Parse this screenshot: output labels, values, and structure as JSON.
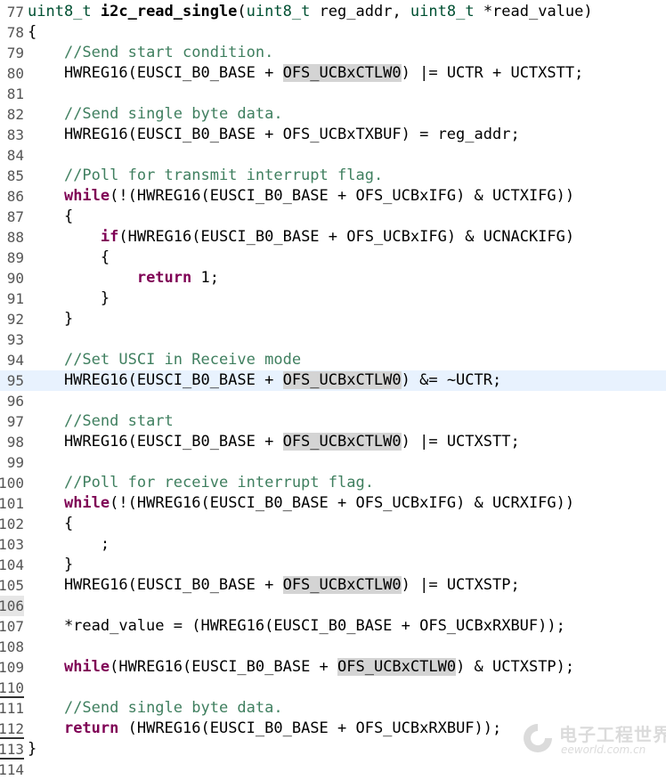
{
  "editor": {
    "language": "c",
    "current_line": "95",
    "lines": [
      {
        "num": "77",
        "tokens": [
          [
            "ty",
            "uint8_t "
          ],
          [
            "fn",
            "i2c_read_single"
          ],
          [
            "",
            "("
          ],
          [
            "ty",
            "uint8_t"
          ],
          [
            "",
            " reg_addr, "
          ],
          [
            "ty",
            "uint8_t"
          ],
          [
            "",
            " *read_value)"
          ]
        ]
      },
      {
        "num": "78",
        "tokens": [
          [
            "",
            "{"
          ]
        ]
      },
      {
        "num": "79",
        "tokens": [
          [
            "",
            "    "
          ],
          [
            "cm",
            "//Send start condition."
          ]
        ]
      },
      {
        "num": "80",
        "tokens": [
          [
            "",
            "    HWREG16(EUSCI_B0_BASE + "
          ],
          [
            "hl",
            "OFS_UCBxCTLW0"
          ],
          [
            "",
            ") |= UCTR + UCTXSTT;"
          ]
        ]
      },
      {
        "num": "81",
        "tokens": []
      },
      {
        "num": "82",
        "tokens": [
          [
            "",
            "    "
          ],
          [
            "cm",
            "//Send single byte data."
          ]
        ]
      },
      {
        "num": "83",
        "tokens": [
          [
            "",
            "    HWREG16(EUSCI_B0_BASE + OFS_UCBxTXBUF) = reg_addr;"
          ]
        ]
      },
      {
        "num": "84",
        "tokens": []
      },
      {
        "num": "85",
        "tokens": [
          [
            "",
            "    "
          ],
          [
            "cm",
            "//Poll for transmit interrupt flag."
          ]
        ]
      },
      {
        "num": "86",
        "tokens": [
          [
            "",
            "    "
          ],
          [
            "kw",
            "while"
          ],
          [
            "",
            "(!(HWREG16(EUSCI_B0_BASE + OFS_UCBxIFG) & UCTXIFG))"
          ]
        ]
      },
      {
        "num": "87",
        "tokens": [
          [
            "",
            "    {"
          ]
        ]
      },
      {
        "num": "88",
        "tokens": [
          [
            "",
            "        "
          ],
          [
            "kw",
            "if"
          ],
          [
            "",
            "(HWREG16(EUSCI_B0_BASE + OFS_UCBxIFG) & UCNACKIFG)"
          ]
        ]
      },
      {
        "num": "89",
        "tokens": [
          [
            "",
            "        {"
          ]
        ]
      },
      {
        "num": "90",
        "tokens": [
          [
            "",
            "            "
          ],
          [
            "kw",
            "return"
          ],
          [
            "",
            " 1;"
          ]
        ]
      },
      {
        "num": "91",
        "tokens": [
          [
            "",
            "        }"
          ]
        ]
      },
      {
        "num": "92",
        "tokens": [
          [
            "",
            "    }"
          ]
        ]
      },
      {
        "num": "93",
        "tokens": []
      },
      {
        "num": "94",
        "tokens": [
          [
            "",
            "    "
          ],
          [
            "cm",
            "//Set USCI in Receive mode"
          ]
        ]
      },
      {
        "num": "95",
        "tokens": [
          [
            "",
            "    HWREG16(EUSCI_B0_BASE + "
          ],
          [
            "hl",
            "OFS_UCBxCTLW0"
          ],
          [
            "",
            ") &= ~UCTR;"
          ]
        ]
      },
      {
        "num": "96",
        "tokens": []
      },
      {
        "num": "97",
        "tokens": [
          [
            "",
            "    "
          ],
          [
            "cm",
            "//Send start"
          ]
        ]
      },
      {
        "num": "98",
        "tokens": [
          [
            "",
            "    HWREG16(EUSCI_B0_BASE + "
          ],
          [
            "hl",
            "OFS_UCBxCTLW0"
          ],
          [
            "",
            ") |= UCTXSTT;"
          ]
        ]
      },
      {
        "num": "99",
        "tokens": []
      },
      {
        "num": "100",
        "tokens": [
          [
            "",
            "    "
          ],
          [
            "cm",
            "//Poll for receive interrupt flag."
          ]
        ]
      },
      {
        "num": "101",
        "tokens": [
          [
            "",
            "    "
          ],
          [
            "kw",
            "while"
          ],
          [
            "",
            "(!(HWREG16(EUSCI_B0_BASE + OFS_UCBxIFG) & UCRXIFG))"
          ]
        ]
      },
      {
        "num": "102",
        "tokens": [
          [
            "",
            "    {"
          ]
        ]
      },
      {
        "num": "103",
        "tokens": [
          [
            "",
            "        ;"
          ]
        ]
      },
      {
        "num": "104",
        "tokens": [
          [
            "",
            "    }"
          ]
        ]
      },
      {
        "num": "105",
        "tokens": [
          [
            "",
            "    HWREG16(EUSCI_B0_BASE + "
          ],
          [
            "hl",
            "OFS_UCBxCTLW0"
          ],
          [
            "",
            ") |= UCTXSTP;"
          ]
        ]
      },
      {
        "num": "106",
        "tokens": []
      },
      {
        "num": "107",
        "tokens": [
          [
            "",
            "    *read_value = (HWREG16(EUSCI_B0_BASE + OFS_UCBxRXBUF));"
          ]
        ]
      },
      {
        "num": "108",
        "tokens": []
      },
      {
        "num": "109",
        "tokens": [
          [
            "",
            "    "
          ],
          [
            "kw",
            "while"
          ],
          [
            "",
            "(HWREG16(EUSCI_B0_BASE + "
          ],
          [
            "hl",
            "OFS_UCBxCTLW0"
          ],
          [
            "",
            ") & UCTXSTP);"
          ]
        ]
      },
      {
        "num": "110",
        "tokens": []
      },
      {
        "num": "111",
        "tokens": [
          [
            "",
            "    "
          ],
          [
            "cm",
            "//Send single byte data."
          ]
        ]
      },
      {
        "num": "112",
        "tokens": [
          [
            "",
            "    "
          ],
          [
            "kw",
            "return"
          ],
          [
            "",
            " (HWREG16(EUSCI_B0_BASE + OFS_UCBxRXBUF));"
          ]
        ]
      },
      {
        "num": "113",
        "tokens": [
          [
            "",
            "}"
          ]
        ]
      },
      {
        "num": "114",
        "tokens": []
      }
    ],
    "marked_lines": [
      "106"
    ],
    "underlined_lines": [
      "110",
      "112",
      "113"
    ]
  },
  "watermark": {
    "text_cn": "电子工程世界",
    "text_en": "eeworld.com.cn"
  },
  "colors": {
    "keyword": "#7f0055",
    "type": "#005032",
    "comment": "#3f7f5f",
    "occurrence_highlight": "#d4d4d4",
    "current_line": "#e8f2fe"
  }
}
